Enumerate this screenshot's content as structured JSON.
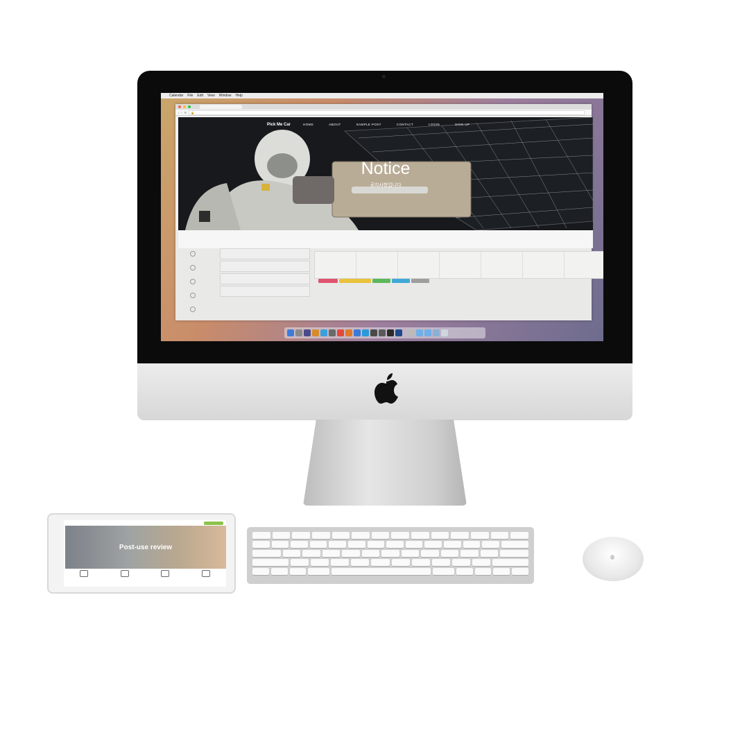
{
  "desktop": {
    "menubar_items": [
      "Calendar",
      "File",
      "Edit",
      "View",
      "Window",
      "Help"
    ],
    "browser": {
      "tab_title": "",
      "url": "",
      "site": {
        "brand": "Pick Me Car",
        "nav": [
          "HOME",
          "ABOUT",
          "SAMPLE POST",
          "CONTACT",
          "LOGIN",
          "SIGN UP"
        ],
        "hero_title": "Notice",
        "hero_subtitle": "공지사항입니다"
      }
    }
  },
  "tablet": {
    "hero_title": "Post-use review"
  },
  "colors": {
    "tag_colors": [
      "#e0546f",
      "#e8c23a",
      "#5cb85c",
      "#3fa9d8",
      "#9e9e9e"
    ]
  }
}
